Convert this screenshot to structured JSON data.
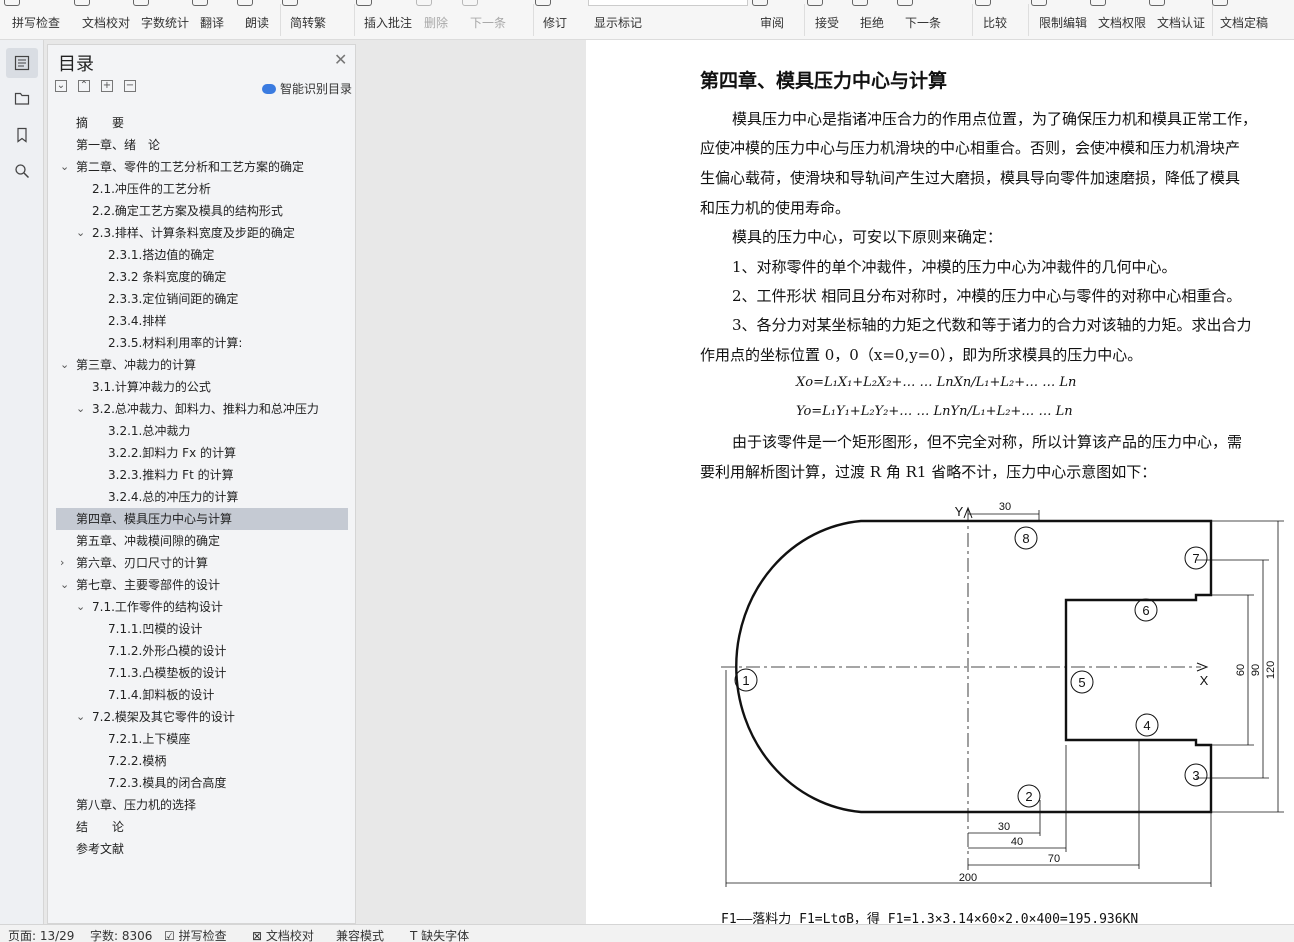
{
  "ribbon": {
    "buttons": [
      "拼写检查",
      "文档校对",
      "字数统计",
      "翻译",
      "朗读",
      "简转繁",
      "插入批注",
      "删除",
      "下一条",
      "修订",
      "显示标记",
      "审阅",
      "接受",
      "拒绝",
      "下一条",
      "比较",
      "限制编辑",
      "文档权限",
      "文档认证",
      "文档定稿"
    ]
  },
  "sidebar_icons": [
    "toc-icon",
    "navigation-icon",
    "bookmark-icon",
    "search-icon"
  ],
  "toc": {
    "title": "目录",
    "smart_label": "智能识别目录",
    "items": [
      {
        "label": "摘　　要"
      },
      {
        "label": "第一章、绪　论"
      },
      {
        "label": "第二章、零件的工艺分析和工艺方案的确定"
      },
      {
        "label": "2.1.冲压件的工艺分析"
      },
      {
        "label": "2.2.确定工艺方案及模具的结构形式"
      },
      {
        "label": "2.3.排样、计算条料宽度及步距的确定"
      },
      {
        "label": "2.3.1.搭边值的确定"
      },
      {
        "label": "2.3.2 条料宽度的确定"
      },
      {
        "label": "2.3.3.定位销间距的确定"
      },
      {
        "label": "2.3.4.排样"
      },
      {
        "label": "2.3.5.材料利用率的计算:"
      },
      {
        "label": "第三章、冲裁力的计算"
      },
      {
        "label": "3.1.计算冲裁力的公式"
      },
      {
        "label": "3.2.总冲裁力、卸料力、推料力和总冲压力"
      },
      {
        "label": "3.2.1.总冲裁力"
      },
      {
        "label": "3.2.2.卸料力 Fx 的计算"
      },
      {
        "label": "3.2.3.推料力 Ft 的计算"
      },
      {
        "label": "3.2.4.总的冲压力的计算"
      },
      {
        "label": "第四章、模具压力中心与计算"
      },
      {
        "label": "第五章、冲裁模间隙的确定"
      },
      {
        "label": "第六章、刃口尺寸的计算"
      },
      {
        "label": "第七章、主要零部件的设计"
      },
      {
        "label": "7.1.工作零件的结构设计"
      },
      {
        "label": "7.1.1.凹模的设计"
      },
      {
        "label": "7.1.2.外形凸模的设计"
      },
      {
        "label": "7.1.3.凸模垫板的设计"
      },
      {
        "label": "7.1.4.卸料板的设计"
      },
      {
        "label": "7.2.模架及其它零件的设计"
      },
      {
        "label": "7.2.1.上下模座"
      },
      {
        "label": "7.2.2.模柄"
      },
      {
        "label": "7.2.3.模具的闭合高度"
      },
      {
        "label": "第八章、压力机的选择"
      },
      {
        "label": "结　　论"
      },
      {
        "label": "参考文献"
      }
    ]
  },
  "document": {
    "chapter_title": "第四章、模具压力中心与计算",
    "paragraphs": [
      "模具压力中心是指诸冲压合力的作用点位置，为了确保压力机和模具正常工作，",
      "应使冲模的压力中心与压力机滑块的中心相重合。否则，会使冲模和压力机滑块产",
      "生偏心载荷，使滑块和导轨间产生过大磨损，模具导向零件加速磨损，降低了模具",
      "和压力机的使用寿命。",
      "模具的压力中心，可安以下原则来确定：",
      "1、对称零件的单个冲裁件，冲模的压力中心为冲裁件的几何中心。",
      "2、工件形状 相同且分布对称时，冲模的压力中心与零件的对称中心相重合。",
      "3、各分力对某坐标轴的力矩之代数和等于诸力的合力对该轴的力矩。求出合力",
      "作用点的坐标位置 0，0（x=0,y=0），即为所求模具的压力中心。",
      "由于该零件是一个矩形图形，但不完全对称，所以计算该产品的压力中心，需",
      "要利用解析图计算，过渡 R 角 R1 省略不计，压力中心示意图如下："
    ],
    "formula_x": "Xo=L₁X₁+L₂X₂+… … LnXn/L₁+L₂+… … Ln",
    "formula_y": "Yo=L₁Y₁+L₂Y₂+… … LnYn/L₁+L₂+… … Ln",
    "footer_line": "F1——落料力  F1=LtσB，得 F1=1.3×3.14×60×2.0×400=195.936KN"
  },
  "diagram": {
    "axis_y": "Y",
    "axis_x": "X",
    "markers": [
      "1",
      "2",
      "3",
      "4",
      "5",
      "6",
      "7",
      "8"
    ],
    "dimensions": [
      "30",
      "30",
      "40",
      "70",
      "200",
      "60",
      "90",
      "120"
    ]
  },
  "status_bar": {
    "page": "页面: 13/29",
    "words": "字数: 8306",
    "spell": "拼写检查",
    "proof": "文档校对",
    "mode": "兼容模式",
    "font": "缺失字体"
  }
}
